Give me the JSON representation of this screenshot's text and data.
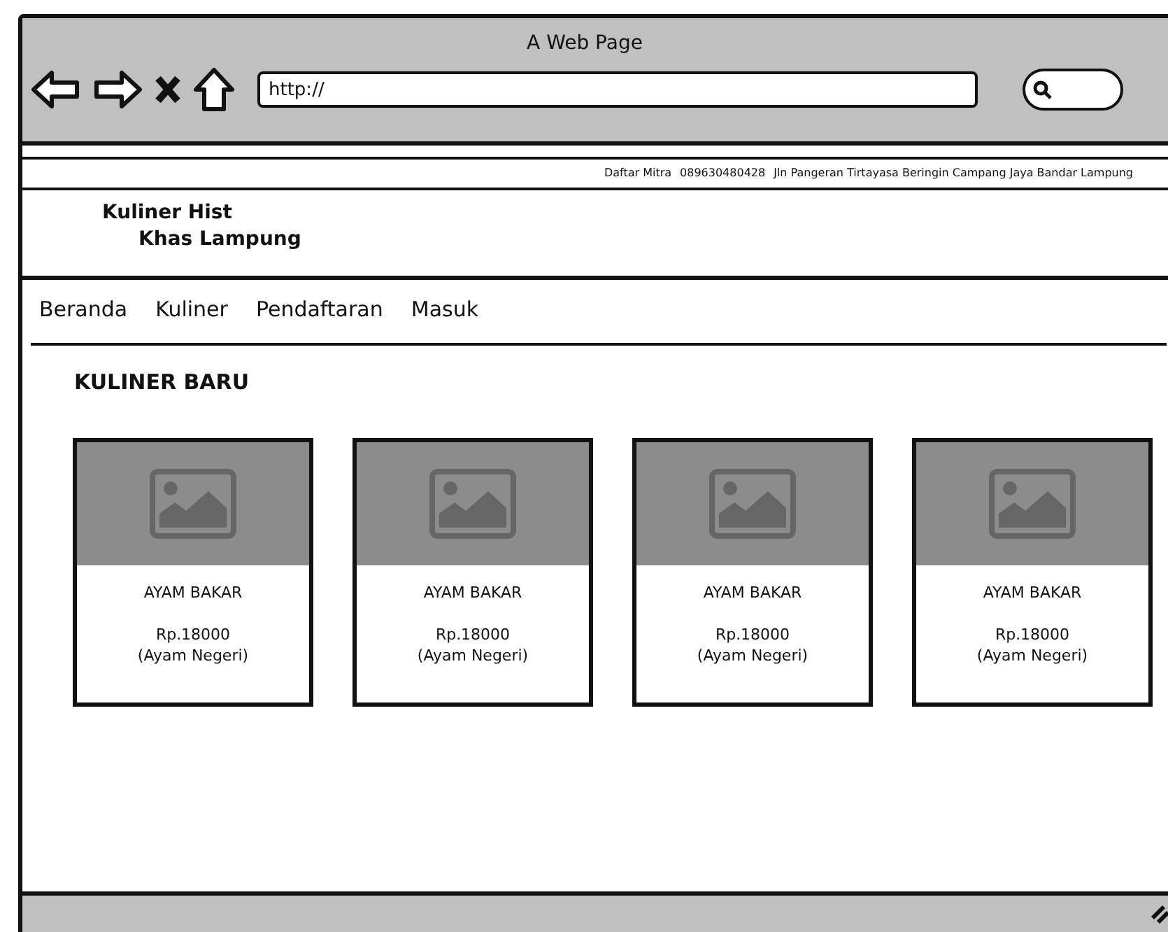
{
  "window": {
    "title": "A Web Page"
  },
  "browser": {
    "address": "http://"
  },
  "top_bar": [
    "Daftar Mitra",
    "089630480428",
    "Jln Pangeran Tirtayasa Beringin Campang Jaya Bandar Lampung"
  ],
  "logo": [
    "Kuliner Hist",
    "Khas Lampung"
  ],
  "nav": [
    "Beranda",
    "Kuliner",
    "Pendaftaran",
    "Masuk"
  ],
  "section": {
    "title": "KULINER BARU",
    "products": [
      {
        "name": "AYAM BAKAR",
        "price": "Rp.18000",
        "note": "(Ayam Negeri)"
      },
      {
        "name": "AYAM BAKAR",
        "price": "Rp.18000",
        "note": "(Ayam Negeri)"
      },
      {
        "name": "AYAM BAKAR",
        "price": "Rp.18000",
        "note": "(Ayam Negeri)"
      },
      {
        "name": "AYAM BAKAR",
        "price": "Rp.18000",
        "note": "(Ayam Negeri)"
      }
    ]
  }
}
